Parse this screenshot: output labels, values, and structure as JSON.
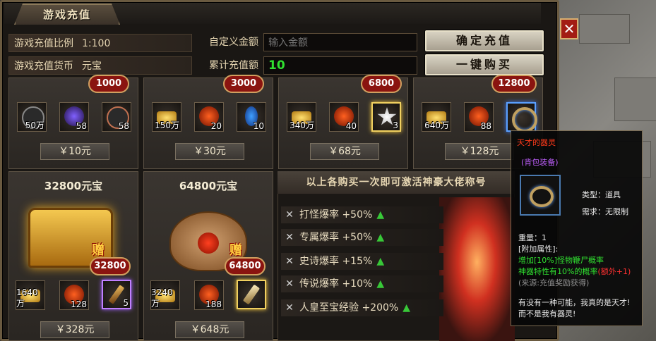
{
  "window": {
    "title": "游戏充值",
    "close_label": "✕"
  },
  "header": {
    "ratio_label": "游戏充值比例",
    "ratio_value": "1:100",
    "currency_label": "游戏充值货币",
    "currency_value": "元宝",
    "custom_amount_label": "自定义金额",
    "custom_amount_placeholder": "输入金额",
    "total_label": "累计充值额",
    "total_value": "10",
    "confirm_button": "确定充值",
    "buy_all_button": "一键购买"
  },
  "packages_top": [
    {
      "pill": "1000",
      "price": "￥10元",
      "items": [
        {
          "icon": "skull-orb-icon",
          "count": "50万"
        },
        {
          "icon": "violet-orb-icon",
          "count": "58"
        },
        {
          "icon": "skull-orb-icon",
          "count": "58"
        }
      ]
    },
    {
      "pill": "3000",
      "price": "￥30元",
      "items": [
        {
          "icon": "gold-ingot-icon",
          "count": "150万"
        },
        {
          "icon": "fire-orb-icon",
          "count": "20"
        },
        {
          "icon": "potion-icon",
          "count": "10"
        }
      ]
    },
    {
      "pill": "6800",
      "price": "￥68元",
      "items": [
        {
          "icon": "gold-ingot-icon",
          "count": "340万"
        },
        {
          "icon": "fire-orb-icon",
          "count": "40"
        },
        {
          "icon": "star-gem-icon",
          "count": "3"
        }
      ]
    },
    {
      "pill": "12800",
      "price": "￥128元",
      "items": [
        {
          "icon": "gold-ingot-icon",
          "count": "640万"
        },
        {
          "icon": "fire-orb-icon",
          "count": "88"
        },
        {
          "icon": "ring-bracelet-icon",
          "count": ""
        }
      ]
    }
  ],
  "packages_bottom": [
    {
      "title": "32800元宝",
      "bonus_tag": "赠",
      "pill": "32800",
      "price": "￥328元",
      "items": [
        {
          "icon": "gold-ingot-icon",
          "count": "1640万"
        },
        {
          "icon": "fire-orb-icon",
          "count": "128"
        },
        {
          "icon": "scroll-blade-icon",
          "count": "5"
        }
      ]
    },
    {
      "title": "64800元宝",
      "bonus_tag": "赠",
      "pill": "64800",
      "price": "￥648元",
      "items": [
        {
          "icon": "gold-ingot-icon",
          "count": "3240万"
        },
        {
          "icon": "fire-orb-icon",
          "count": "188"
        },
        {
          "icon": "scroll-blade-icon",
          "count": ""
        }
      ]
    }
  ],
  "bonus_panel": {
    "title": "以上各购买一次即可激活神豪大佬称号",
    "rows": [
      {
        "label": "打怪爆率",
        "value": "+50%"
      },
      {
        "label": "专属爆率",
        "value": "+50%"
      },
      {
        "label": "史诗爆率",
        "value": "+15%"
      },
      {
        "label": "传说爆率",
        "value": "+10%"
      },
      {
        "label": "人皇至宝经验",
        "value": "+200%"
      }
    ]
  },
  "tooltip": {
    "name": "天才的器灵",
    "source_tag": "(背包装备)",
    "type_label": "类型：道具",
    "require_label": "需求：无限制",
    "weight": "重量：1",
    "attr_header": "[附加属性]:",
    "attr1": "增加[10%]怪物鞭尸概率",
    "attr2_prefix": "神器特性有10%的概率",
    "attr2_suffix": "(额外+1)",
    "source": "(来源:充值奖励获得)",
    "flavor1": "有没有一种可能，我真的是天才!",
    "flavor2": "而不是我有器灵!"
  },
  "colors": {
    "tip_name": "#ff3a1a",
    "tip_tag": "#c060ff",
    "tip_attr": "#30e030",
    "tip_extra": "#ff3030",
    "total_value": "#30e030"
  }
}
